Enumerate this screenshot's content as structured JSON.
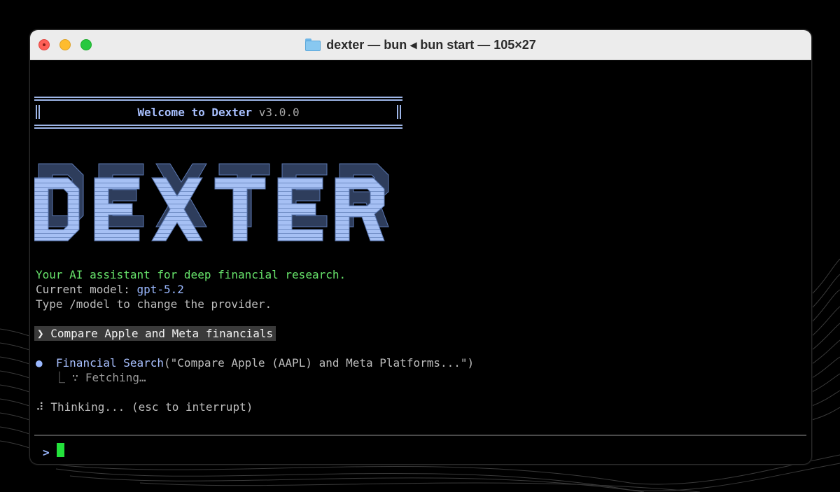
{
  "window": {
    "title": "dexter — bun ◂ bun start — 105×27",
    "folder_icon": "folder-icon"
  },
  "welcome": {
    "greeting": "Welcome to Dexter",
    "version": "v3.0.0"
  },
  "logo_text": "DEXTER",
  "intro": {
    "tagline": "Your AI assistant for deep financial research.",
    "model_label": "Current model: ",
    "model_value": "gpt-5.2",
    "hint": "Type /model to change the provider."
  },
  "history": {
    "user_prompt": "❯ Compare Apple and Meta financials",
    "tool_bullet": "●",
    "tool_name": "Financial Search",
    "tool_args": "(\"Compare Apple (AAPL) and Meta Platforms...\")",
    "tool_status": "⎿ ∵ Fetching…",
    "thinking": "⠼ Thinking... (esc to interrupt)"
  },
  "input": {
    "prompt_symbol": ">",
    "value": ""
  },
  "colors": {
    "accent_blue": "#9ab8ff",
    "tagline_green": "#67e36b",
    "cursor_green": "#23e23b",
    "title_bar": "#ececec"
  }
}
